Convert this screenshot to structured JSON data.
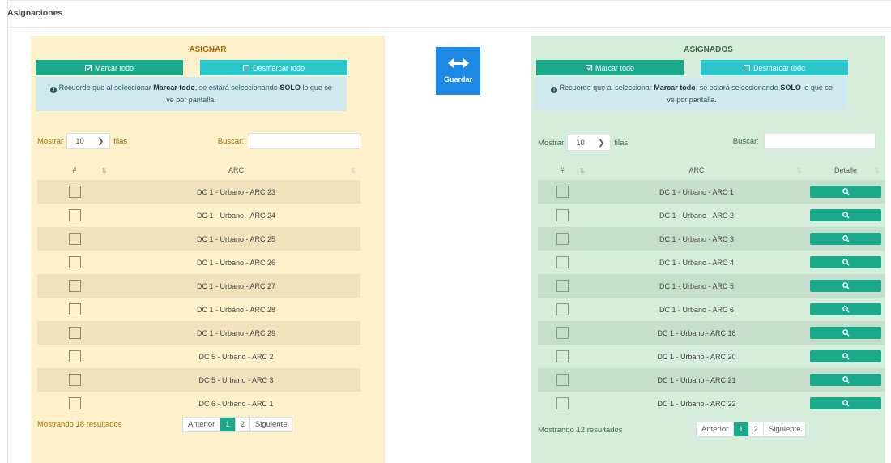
{
  "page": {
    "title": "Asignaciones"
  },
  "save_button": {
    "label": "Guardar",
    "icon": "arrows-horizontal-icon"
  },
  "assign_panel": {
    "title": "ASIGNAR",
    "mark_all": "Marcar todo",
    "unmark_all": "Desmarcar todo",
    "info_pre": " Recuerde que al seleccionar ",
    "info_bold1": "Marcar todo",
    "info_mid": ", se estará seleccionando ",
    "info_bold2": "SOLO",
    "info_post": " lo que se ve por pantalla.",
    "length_prefix": "Mostrar",
    "length_value": "10",
    "length_suffix": "filas",
    "search_label": "Buscar:",
    "search_value": "",
    "col_num": "#",
    "col_arc": "ARC",
    "rows": [
      "DC 1 - Urbano - ARC 23",
      "DC 1 - Urbano - ARC 24",
      "DC 1 - Urbano - ARC 25",
      "DC 1 - Urbano - ARC 26",
      "DC 1 - Urbano - ARC 27",
      "DC 1 - Urbano - ARC 28",
      "DC 1 - Urbano - ARC 29",
      "DC 5 - Urbano - ARC 2",
      "DC 5 - Urbano - ARC 3",
      "DC 6 - Urbano - ARC 1"
    ],
    "summary": "Mostrando 18 resultados",
    "pager": {
      "prev": "Anterior",
      "p1": "1",
      "p2": "2",
      "next": "Siguiente"
    }
  },
  "assigned_panel": {
    "title": "ASIGNADOS",
    "mark_all": "Marcar todo",
    "unmark_all": "Desmarcar todo",
    "info_pre": " Recuerde que al seleccionar ",
    "info_bold1": "Marcar todo",
    "info_mid": ", se estará seleccionando ",
    "info_bold2": "SOLO",
    "info_post": " lo que se ve por pantalla.",
    "length_prefix": "Mostrar",
    "length_value": "10",
    "length_suffix": "filas",
    "search_label": "Buscar:",
    "search_value": "",
    "col_num": "#",
    "col_arc": "ARC",
    "col_detail": "Detalle",
    "rows": [
      "DC 1 - Urbano - ARC 1",
      "DC 1 - Urbano - ARC 2",
      "DC 1 - Urbano - ARC 3",
      "DC 1 - Urbano - ARC 4",
      "DC 1 - Urbano - ARC 5",
      "DC 1 - Urbano - ARC 6",
      "DC 1 - Urbano - ARC 18",
      "DC 1 - Urbano - ARC 20",
      "DC 1 - Urbano - ARC 21",
      "DC 1 - Urbano - ARC 22"
    ],
    "summary": "Mostrando 12 resultados",
    "pager": {
      "prev": "Anterior",
      "p1": "1",
      "p2": "2",
      "next": "Siguiente"
    }
  },
  "colors": {
    "assign_bg": "#fdf1cc",
    "assigned_bg": "#d6eddc",
    "primary_green": "#1aa98a",
    "cyan": "#29c6cc",
    "save_blue": "#1e88e5",
    "info_bg": "#cfe9ef"
  }
}
